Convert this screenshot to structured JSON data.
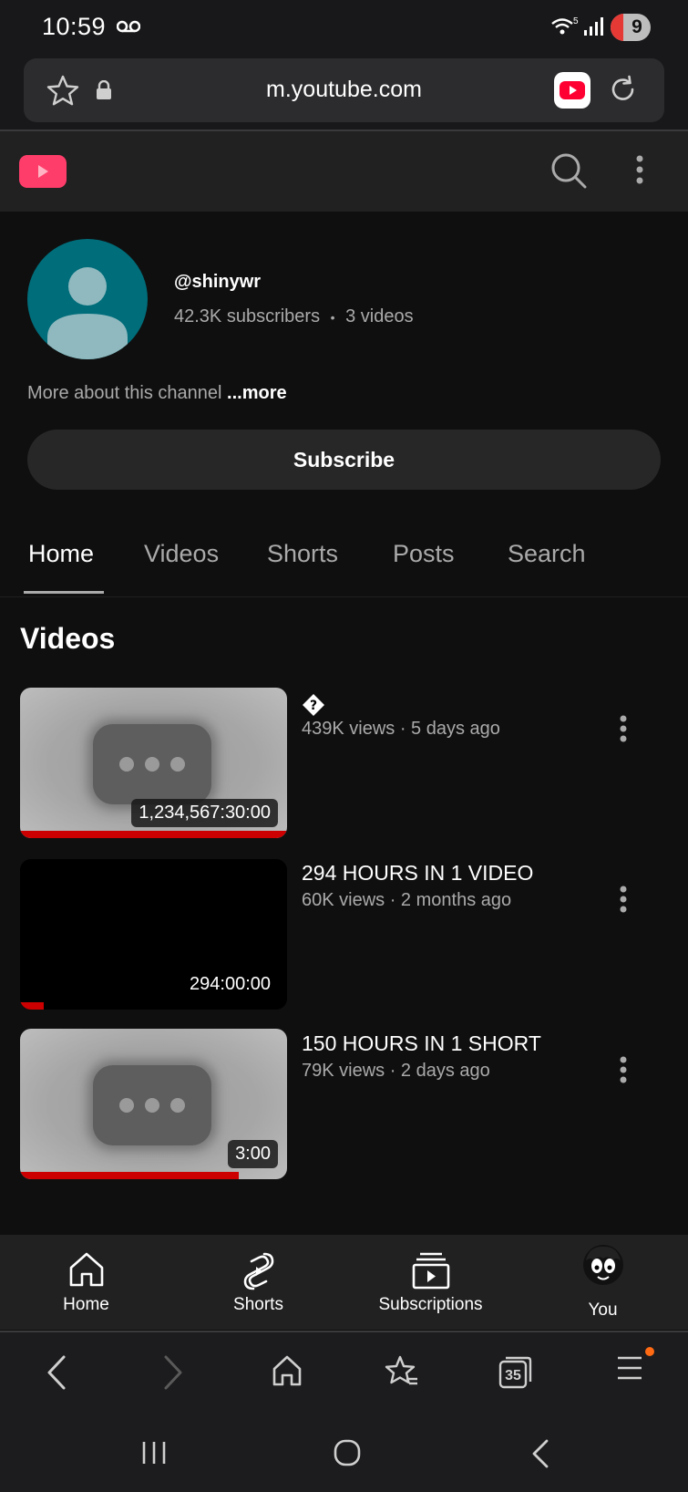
{
  "status_bar": {
    "time": "10:59",
    "battery_level": "9",
    "wifi_label": "5"
  },
  "browser": {
    "url": "m.youtube.com",
    "tab_count": "35"
  },
  "channel": {
    "handle": "@shinywr",
    "subscribers": "42.3K subscribers",
    "separator": "•",
    "video_count": "3 videos",
    "about_text": "More about this channel",
    "about_more": "...more",
    "subscribe_label": "Subscribe"
  },
  "tabs": [
    {
      "label": "Home",
      "active": true
    },
    {
      "label": "Videos",
      "active": false
    },
    {
      "label": "Shorts",
      "active": false
    },
    {
      "label": "Posts",
      "active": false
    },
    {
      "label": "Search",
      "active": false
    }
  ],
  "section_title": "Videos",
  "videos": [
    {
      "title": "",
      "title_icon": "question-diamond-icon",
      "meta": "439K views · 5 days ago",
      "duration": "1,234,567:30:00",
      "thumbnail": "placeholder-gray",
      "watch_progress": 1.0
    },
    {
      "title": "294 HOURS IN 1 VIDEO",
      "meta": "60K views · 2 months ago",
      "duration": "294:00:00",
      "thumbnail": "black",
      "watch_progress": 0.09
    },
    {
      "title": "150 HOURS IN 1 SHORT",
      "meta": "79K views · 2 days ago",
      "duration": "3:00",
      "thumbnail": "placeholder-gray",
      "watch_progress": 0.82
    }
  ],
  "bottom_nav": [
    {
      "label": "Home",
      "icon": "home-icon"
    },
    {
      "label": "Shorts",
      "icon": "shorts-icon"
    },
    {
      "label": "Subscriptions",
      "icon": "subscriptions-icon"
    },
    {
      "label": "You",
      "icon": "profile-avatar"
    }
  ],
  "colors": {
    "accent_red": "#cc0000",
    "youtube_logo_pink": "#ff3d6a",
    "avatar_teal": "#006d7a",
    "notification_orange": "#ff6a13"
  }
}
